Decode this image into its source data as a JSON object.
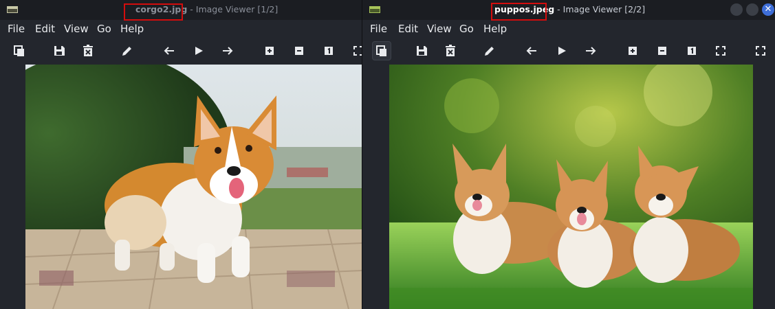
{
  "windows": [
    {
      "title_filename": "corgo2.jpg",
      "title_rest": " - Image Viewer [1/2]",
      "menu": [
        "File",
        "Edit",
        "View",
        "Go",
        "Help"
      ],
      "toolbar_icons": [
        "copy-icon",
        "save-icon",
        "delete-icon",
        "edit-icon",
        "back-arrow-icon",
        "play-icon",
        "forward-arrow-icon",
        "zoom-in-icon",
        "zoom-out-icon",
        "actual-size-icon",
        "fullscreen-icon"
      ],
      "image_alt": "corgi on paving stones"
    },
    {
      "title_filename": "puppos.jpeg",
      "title_rest": " - Image Viewer [2/2]",
      "menu": [
        "File",
        "Edit",
        "View",
        "Go",
        "Help"
      ],
      "toolbar_icons": [
        "copy-icon",
        "save-icon",
        "delete-icon",
        "edit-icon",
        "back-arrow-icon",
        "play-icon",
        "forward-arrow-icon",
        "zoom-in-icon",
        "zoom-out-icon",
        "actual-size-icon",
        "fit-icon",
        "fullscreen-icon"
      ],
      "image_alt": "three corgis on grass",
      "close_glyph": "✕"
    }
  ],
  "colors": {
    "highlight": "#d40d0d",
    "close_button": "#3e6ed8",
    "background": "#23262d"
  }
}
